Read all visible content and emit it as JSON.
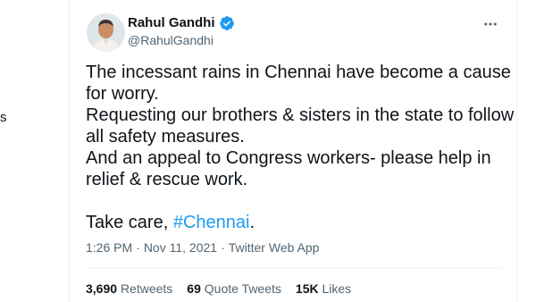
{
  "left_column": {
    "glyph": "s"
  },
  "tweet": {
    "author": {
      "name": "Rahul Gandhi",
      "handle": "@RahulGandhi",
      "verified": true,
      "avatar_icon": "user-avatar"
    },
    "text_lines": [
      "The incessant rains in Chennai have become a cause",
      "for worry.",
      "Requesting our brothers & sisters in the state to follow",
      "all safety measures.",
      "And an appeal to Congress workers- please help in",
      "relief & rescue work."
    ],
    "closing": {
      "text": "Take care, ",
      "hashtag": "#Chennai",
      "suffix": "."
    },
    "meta": {
      "time": "1:26 PM",
      "separator": "·",
      "date": "Nov 11, 2021",
      "source": "Twitter Web App"
    },
    "stats": {
      "retweets_count": "3,690",
      "retweets_label": "Retweets",
      "quote_count": "69",
      "quote_label": "Quote Tweets",
      "likes_count": "15K",
      "likes_label": "Likes"
    }
  },
  "colors": {
    "accent": "#1d9bf0",
    "text": "#0f1419",
    "secondary": "#536471",
    "border": "#eff3f4"
  }
}
